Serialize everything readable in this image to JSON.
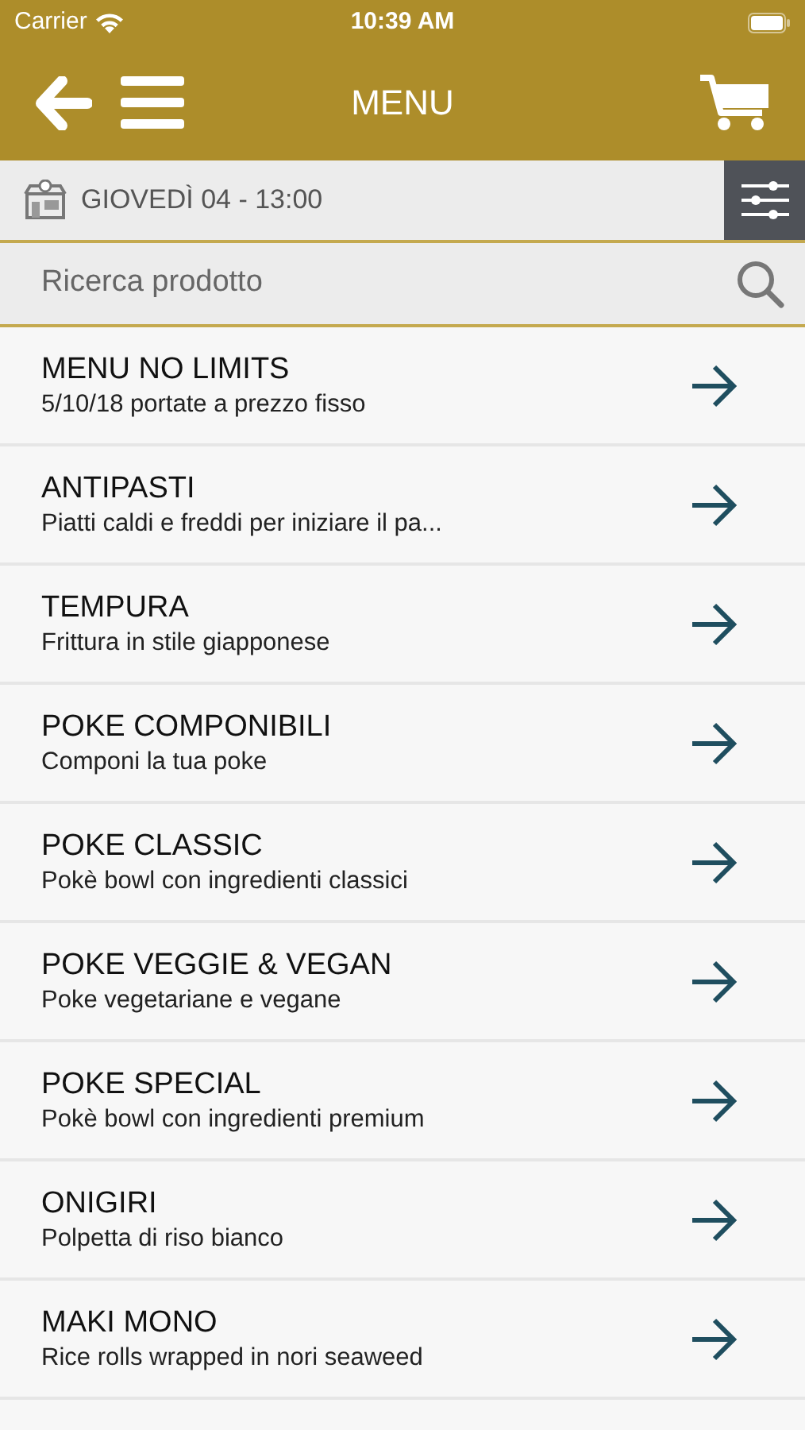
{
  "status_bar": {
    "carrier": "Carrier",
    "time": "10:39 AM"
  },
  "header": {
    "title": "MENU"
  },
  "delivery": {
    "label": "GIOVEDÌ 04 - 13:00"
  },
  "search": {
    "placeholder": "Ricerca prodotto"
  },
  "categories": [
    {
      "title": "MENU NO LIMITS",
      "subtitle": "5/10/18 portate a prezzo fisso"
    },
    {
      "title": "ANTIPASTI",
      "subtitle": "Piatti caldi e freddi per iniziare il pa..."
    },
    {
      "title": "TEMPURA",
      "subtitle": "Frittura in stile giapponese"
    },
    {
      "title": "POKE COMPONIBILI",
      "subtitle": "Componi la tua poke"
    },
    {
      "title": "POKE CLASSIC",
      "subtitle": "Pokè bowl con ingredienti classici"
    },
    {
      "title": "POKE VEGGIE & VEGAN",
      "subtitle": "Poke vegetariane e vegane"
    },
    {
      "title": "POKE SPECIAL",
      "subtitle": "Pokè bowl con ingredienti premium"
    },
    {
      "title": "ONIGIRI",
      "subtitle": "Polpetta di riso bianco"
    },
    {
      "title": "MAKI MONO",
      "subtitle": "Rice rolls wrapped in nori seaweed"
    }
  ]
}
